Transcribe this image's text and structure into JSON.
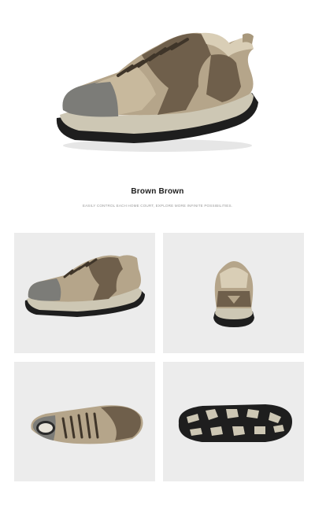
{
  "product": {
    "color_name": "Brown Brown",
    "tagline": "EASILY CONTROL EACH HOME COURT, EXPLORE MORE INFINITE POSSIBILITIES."
  },
  "images": {
    "hero": "hiking-shoe-side-view",
    "gallery": [
      "shoe-side-view",
      "shoe-back-view",
      "shoe-top-view",
      "shoe-outsole-view"
    ]
  },
  "colors": {
    "tile_background": "#ececec",
    "upper_khaki": "#b5a58a",
    "overlay_brown": "#6f5f4b",
    "toe_grey": "#7c7c78",
    "sole_black": "#1e1e1e",
    "midsole": "#cdc7b4"
  }
}
